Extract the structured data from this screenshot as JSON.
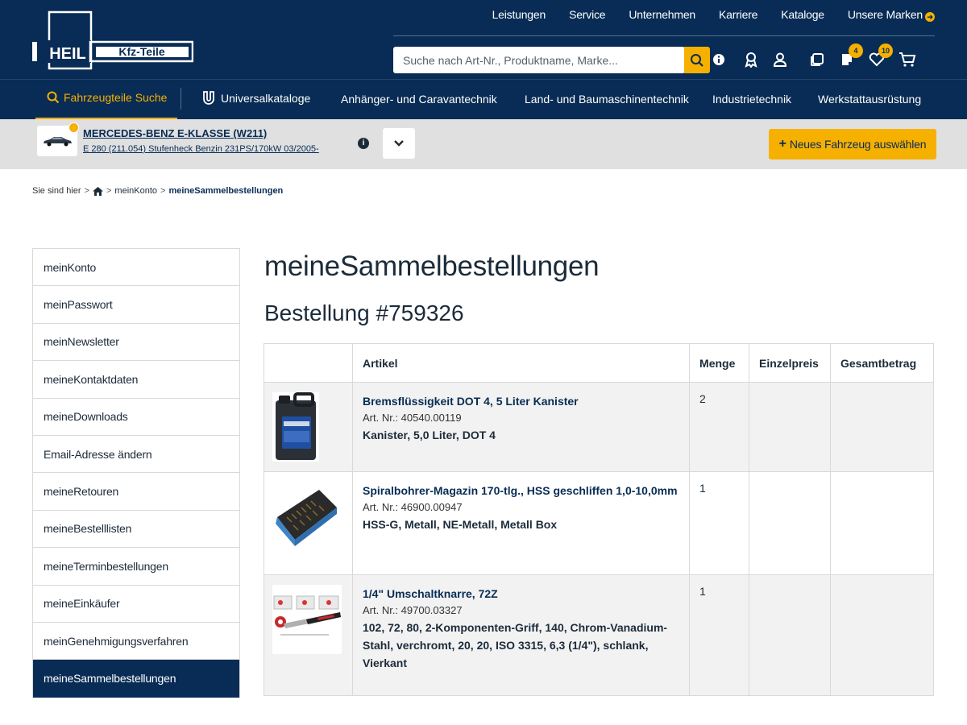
{
  "header": {
    "logo_text_left": "HEIL",
    "logo_text_right": "Kfz-Teile",
    "topnav": [
      "Leistungen",
      "Service",
      "Unternehmen",
      "Karriere",
      "Kataloge",
      "Unsere Marken"
    ],
    "search_placeholder": "Suche nach Art-Nr., Produktname, Marke...",
    "icons": [
      "info-icon",
      "award-icon",
      "user-icon",
      "copy-icon",
      "notes-icon",
      "heart-icon",
      "cart-icon"
    ],
    "badge_notes": "4",
    "badge_heart": "10"
  },
  "catnav": {
    "items": [
      "Fahrzeugteile Suche",
      "Universalkataloge",
      "Anhänger- und Caravantechnik",
      "Land- und Baumaschinentechnik",
      "Industrietechnik",
      "Werkstattausrüstung"
    ]
  },
  "vehicle": {
    "title": "MERCEDES-BENZ E-KLASSE (W211)",
    "subtitle": "E 280 (211.054) Stufenheck Benzin 231PS/170kW 03/2005-",
    "new_vehicle_label": "Neues Fahrzeug auswählen"
  },
  "breadcrumb": {
    "prefix": "Sie sind hier",
    "items": [
      "meinKonto",
      "meineSammelbestellungen"
    ]
  },
  "sidebar": {
    "items": [
      {
        "label": "meinKonto",
        "active": false
      },
      {
        "label": "meinPasswort",
        "active": false
      },
      {
        "label": "meinNewsletter",
        "active": false
      },
      {
        "label": "meineKontaktdaten",
        "active": false
      },
      {
        "label": "meineDownloads",
        "active": false
      },
      {
        "label": "Email-Adresse ändern",
        "active": false
      },
      {
        "label": "meineRetouren",
        "active": false
      },
      {
        "label": "meineBestelllisten",
        "active": false
      },
      {
        "label": "meineTerminbestellungen",
        "active": false
      },
      {
        "label": "meineEinkäufer",
        "active": false
      },
      {
        "label": "meinGenehmigungsverfahren",
        "active": false
      },
      {
        "label": "meineSammelbestellungen",
        "active": true
      }
    ]
  },
  "main": {
    "title": "meineSammelbestellungen",
    "order_title": "Bestellung #759326",
    "table": {
      "headers": [
        "",
        "Artikel",
        "Menge",
        "Einzelpreis",
        "Gesamtbetrag"
      ],
      "rows": [
        {
          "image": "brake-fluid-canister-image",
          "name": "Bremsflüssigkeit DOT 4, 5 Liter Kanister",
          "art_nr": "Art. Nr.: 40540.00119",
          "desc": "Kanister, 5,0 Liter, DOT 4",
          "qty": "2",
          "unit_price": "",
          "total": ""
        },
        {
          "image": "drill-bit-case-image",
          "name": "Spiralbohrer-Magazin 170-tlg., HSS geschliffen 1,0-10,0mm",
          "art_nr": "Art. Nr.: 46900.00947",
          "desc": "HSS-G, Metall, NE-Metall, Metall Box",
          "qty": "1",
          "unit_price": "",
          "total": ""
        },
        {
          "image": "ratchet-image",
          "name": "1/4\" Umschaltknarre, 72Z",
          "art_nr": "Art. Nr.: 49700.03327",
          "desc": "102, 72, 80, 2-Komponenten-Griff, 140, Chrom-Vanadium-Stahl, verchromt, 20, 20, ISO 3315, 6,3 (1/4\"), schlank, Vierkant",
          "qty": "1",
          "unit_price": "",
          "total": ""
        }
      ]
    }
  },
  "colors": {
    "navy": "#082c55",
    "accent": "#f6b000",
    "vehicle_bar": "#e0e0e0",
    "row_gray": "#f2f2f2"
  }
}
